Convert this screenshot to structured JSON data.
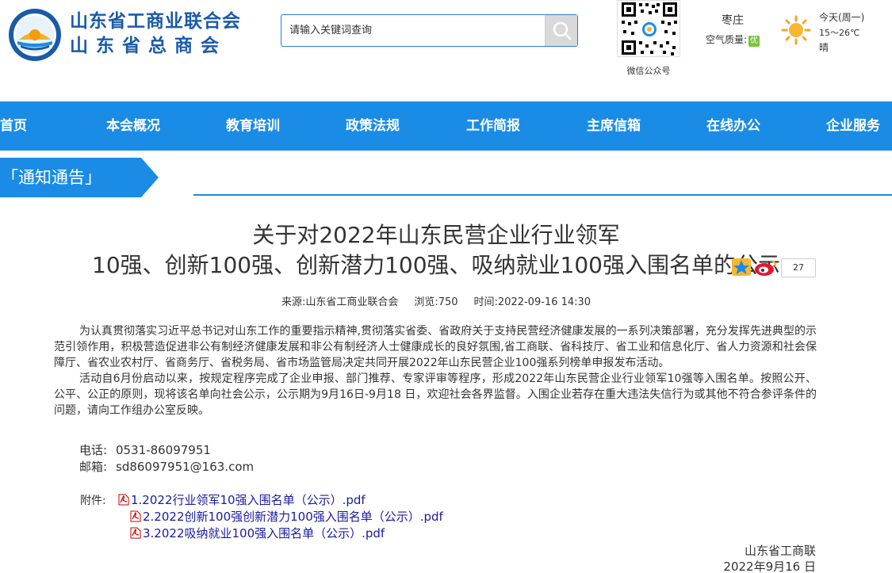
{
  "header": {
    "org_name_line1": "山东省工商业联合会",
    "org_name_line2": "山东省总商会",
    "search_placeholder": "请输入关键词查询",
    "qr_caption": "微信公众号",
    "weather": {
      "city": "枣庄",
      "aqi_label": "空气质量:",
      "aqi_value": "优",
      "day": "今天(周一)",
      "temp": "15～26℃",
      "condition": "晴"
    }
  },
  "nav": {
    "items": [
      {
        "label": "首页"
      },
      {
        "label": "本会概况"
      },
      {
        "label": "教育培训"
      },
      {
        "label": "政策法规"
      },
      {
        "label": "工作简报"
      },
      {
        "label": "主席信箱"
      },
      {
        "label": "在线办公"
      },
      {
        "label": "企业服务"
      }
    ]
  },
  "section": {
    "label": "「通知通告」"
  },
  "article": {
    "title_line1": "关于对2022年山东民营企业行业领军",
    "title_line2": "10强、创新100强、创新潜力100强、吸纳就业100强入围名单的公示",
    "share_count": "27",
    "meta": {
      "source": "来源:山东省工商业联合会",
      "views": "浏览:750",
      "time": "时间:2022-09-16 14:30"
    },
    "paragraphs": [
      "为认真贯彻落实习近平总书记对山东工作的重要指示精神,贯彻落实省委、省政府关于支持民营经济健康发展的一系列决策部署，充分发挥先进典型的示范引领作用，积极营造促进非公有制经济健康发展和非公有制经济人士健康成长的良好氛围,省工商联、省科技厅、省工业和信息化厅、省人力资源和社会保障厅、省农业农村厅、省商务厅、省税务局、省市场监管局决定共同开展2022年山东民营企业100强系列榜单申报发布活动。",
      "活动自6月份启动以来，按规定程序完成了企业申报、部门推荐、专家评审等程序，形成2022年山东民营企业行业领军10强等入围名单。按照公开、公平、公正的原则，现将该名单向社会公示，公示期为9月16日-9月18 日，欢迎社会各界监督。入围企业若存在重大违法失信行为或其他不符合参评条件的问题，请向工作组办公室反映。"
    ],
    "contact": {
      "phone_label": "电话:",
      "phone": "0531-86097951",
      "email_label": "邮箱:",
      "email": "sd86097951@163.com"
    },
    "attachments_label": "附件:",
    "attachments": [
      {
        "label": "1.2022行业领军10强入围名单（公示）.pdf"
      },
      {
        "label": "2.2022创新100强创新潜力100强入围名单（公示）.pdf"
      },
      {
        "label": "3.2022吸纳就业100强入围名单（公示）.pdf"
      }
    ],
    "signature": "山东省工商联",
    "date": "2022年9月16 日"
  },
  "colors": {
    "brand_blue": "#1a8ce6",
    "org_text_blue": "#1a5ba8",
    "link_blue": "#1a1aa0"
  }
}
